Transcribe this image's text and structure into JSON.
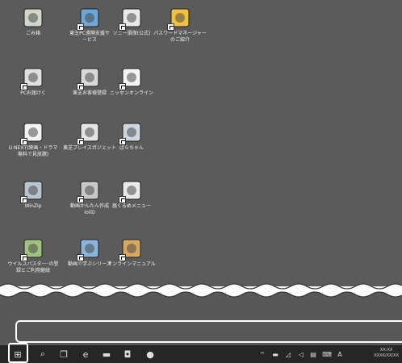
{
  "desktop": {
    "icons": [
      {
        "label": "ごみ箱",
        "icon": "recycle-bin-icon"
      },
      {
        "label": "東芝PC遠隔支援サ\nービス",
        "icon": "remote-support-icon"
      },
      {
        "label": "ソニー損保(公式)",
        "icon": "car-insurance-icon"
      },
      {
        "label": "パスワードマネージャー\nのご紹介",
        "icon": "password-manager-icon"
      },
      {
        "label": "PCお届けく",
        "icon": "pc-delivery-icon"
      },
      {
        "label": "東芝お客様登録",
        "icon": "customer-registration-icon"
      },
      {
        "label": "ニッセンオンライン",
        "icon": "nissen-online-icon"
      },
      {
        "label": "U-NEXT(映画・ドラマ\n無料で見放題)",
        "icon": "u-next-icon"
      },
      {
        "label": "東芝プレイスガジェット",
        "icon": "places-gadget-icon"
      },
      {
        "label": "ばらちゃん",
        "icon": "bird-app-icon"
      },
      {
        "label": "WinZip",
        "icon": "winzip-icon"
      },
      {
        "label": "動画かんたん作成\nIoliD",
        "icon": "video-maker-icon"
      },
      {
        "label": "届くるめメニュー",
        "icon": "menu-app-icon"
      },
      {
        "label": "ウイルスバスター･の登\n録とご利用継続",
        "icon": "virus-buster-icon"
      },
      {
        "label": "動画で学ぶシリーズ",
        "icon": "video-learning-icon"
      },
      {
        "label": "オンラインマニュアル",
        "icon": "online-manual-icon"
      }
    ]
  },
  "taskbar": {
    "start": {
      "icon": "windows-start-icon",
      "glyph": "⊞"
    },
    "apps": [
      {
        "icon": "search-icon",
        "glyph": "⌕"
      },
      {
        "icon": "task-view-icon",
        "glyph": "❐"
      },
      {
        "icon": "edge-icon",
        "glyph": "e"
      },
      {
        "icon": "file-explorer-icon",
        "glyph": "▬"
      },
      {
        "icon": "store-icon",
        "glyph": "◘"
      },
      {
        "icon": "app-icon",
        "glyph": "●"
      }
    ],
    "tray": [
      {
        "icon": "show-hidden-icons-icon",
        "glyph": "^"
      },
      {
        "icon": "battery-icon",
        "glyph": "▬"
      },
      {
        "icon": "network-icon",
        "glyph": "◿"
      },
      {
        "icon": "volume-icon",
        "glyph": "◁"
      },
      {
        "icon": "action-center-icon",
        "glyph": "▤"
      },
      {
        "icon": "keyboard-icon",
        "glyph": "⌨"
      },
      {
        "icon": "ime-icon",
        "glyph": "A"
      }
    ],
    "clock": {
      "time": "XX:XX",
      "date": "XXXX/XX/XX"
    }
  },
  "colors": {
    "desktop": "#5b5b5b",
    "taskbar": "#262626",
    "callout": "#ffffff"
  }
}
